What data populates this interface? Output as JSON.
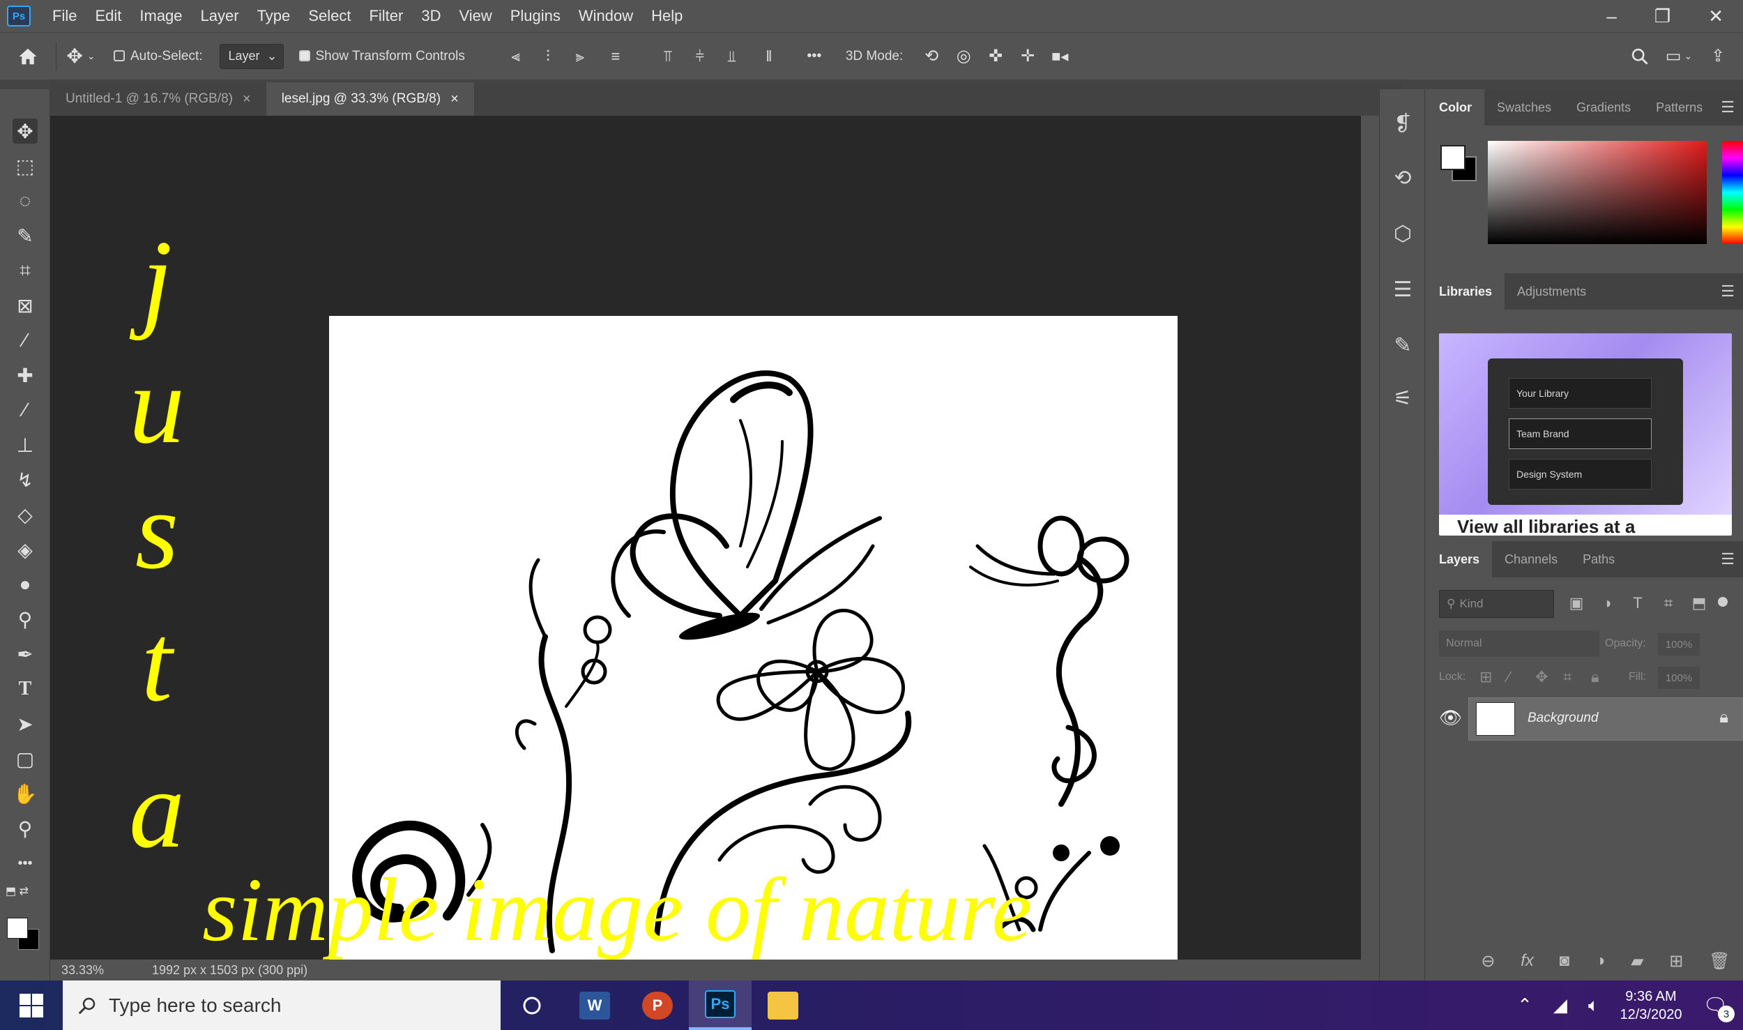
{
  "app": {
    "logo": "Ps"
  },
  "menu": [
    "File",
    "Edit",
    "Image",
    "Layer",
    "Type",
    "Select",
    "Filter",
    "3D",
    "View",
    "Plugins",
    "Window",
    "Help"
  ],
  "window_controls": {
    "minimize": "–",
    "restore": "❐",
    "close": "✕"
  },
  "options_bar": {
    "auto_select_label": "Auto-Select:",
    "auto_select_checked": false,
    "auto_select_target": "Layer",
    "show_transform_label": "Show Transform Controls",
    "show_transform_checked": true,
    "more": "•••",
    "mode_label": "3D Mode:"
  },
  "tabs": [
    {
      "label": "Untitled-1 @ 16.7% (RGB/8)",
      "close": "×",
      "active": false
    },
    {
      "label": "lesel.jpg @ 33.3% (RGB/8)",
      "close": "×",
      "active": true
    }
  ],
  "status": {
    "zoom": "33.33%",
    "doc_info": "1992 px x 1503 px (300 ppi)"
  },
  "color_panel": {
    "tabs": [
      "Color",
      "Swatches",
      "Gradients",
      "Patterns"
    ],
    "fg": "#ffffff",
    "bg": "#000000"
  },
  "libraries_panel": {
    "tabs": [
      "Libraries",
      "Adjustments"
    ],
    "rows": [
      "Your Library",
      "Team Brand",
      "Design System"
    ],
    "caption": "View all libraries at a"
  },
  "layers_panel": {
    "tabs": [
      "Layers",
      "Channels",
      "Paths"
    ],
    "search_placeholder": "Kind",
    "blend_mode": "Normal",
    "opacity_label": "Opacity:",
    "opacity_value": "100%",
    "lock_label": "Lock:",
    "fill_label": "Fill:",
    "fill_value": "100%",
    "layer_name": "Background"
  },
  "overlay": {
    "letters": [
      "j",
      "u",
      "s",
      "t",
      "a"
    ],
    "caption": "simple image of nature",
    "color": "#ffff00"
  },
  "taskbar": {
    "search_placeholder": "Type here to search",
    "time": "9:36 AM",
    "date": "12/3/2020",
    "notification_count": "3"
  }
}
